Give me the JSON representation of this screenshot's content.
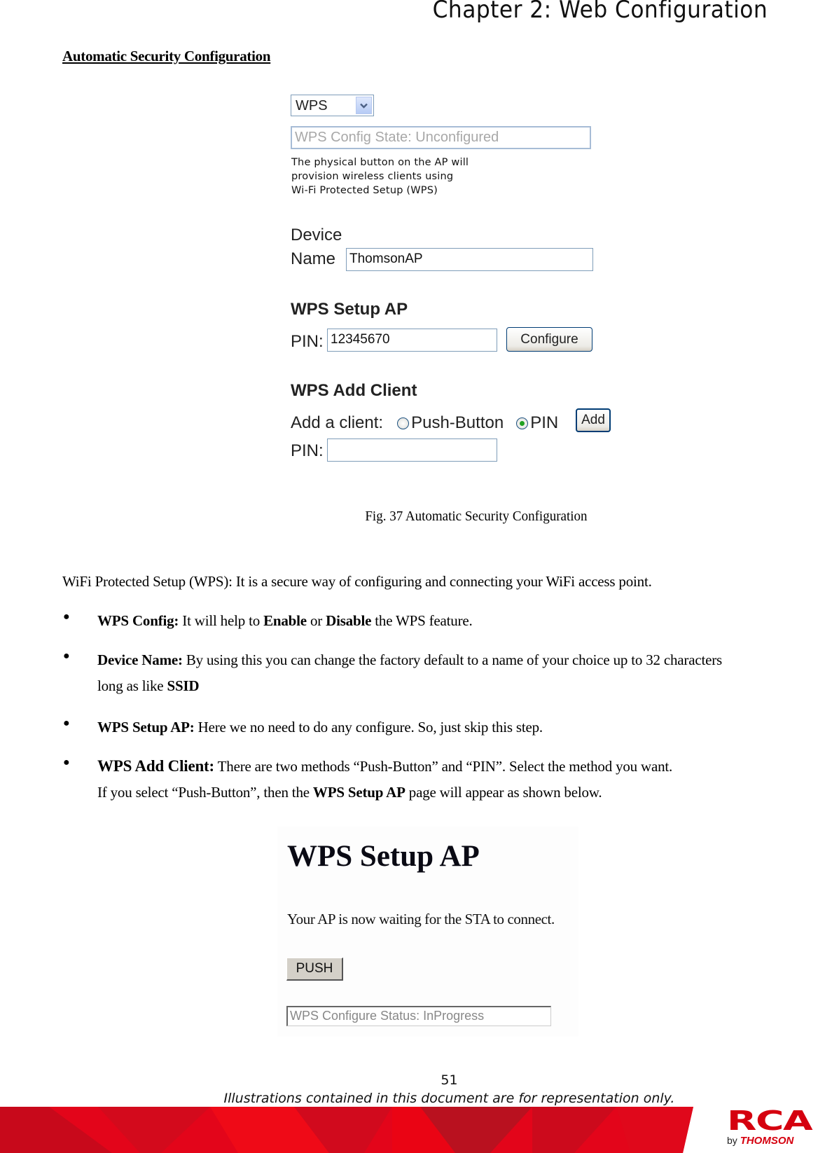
{
  "header": {
    "chapter_title": "Chapter 2: Web Configuration"
  },
  "section": {
    "heading": "Automatic Security Configuration"
  },
  "figure1": {
    "wps_select": {
      "value": "WPS",
      "icon": "chevron-down-icon"
    },
    "config_state": "WPS Config State: Unconfigured",
    "note_lines": [
      "The physical button on the AP will",
      "provision wireless clients using",
      "Wi-Fi Protected Setup (WPS)"
    ],
    "device_label_line1": "Device",
    "device_label_line2": "Name",
    "device_name_value": "ThomsonAP",
    "setup_ap_heading": "WPS Setup AP",
    "pin_label": "PIN:",
    "pin_value": "12345670",
    "configure_button": "Configure",
    "add_client_heading": "WPS Add Client",
    "add_client_label": "Add a client:",
    "radio_options": [
      {
        "label": "Push-Button",
        "selected": false
      },
      {
        "label": "PIN",
        "selected": true
      }
    ],
    "add_button": "Add",
    "pin_label_2": "PIN:",
    "pin_value_2": "",
    "caption": "Fig. 37 Automatic Security Configuration"
  },
  "body": {
    "intro": "WiFi Protected Setup (WPS): It is a secure way of configuring and connecting your WiFi access point.",
    "bullets": [
      {
        "term": "WPS Config:",
        "text_1": " It will help to ",
        "bold_1": "Enable",
        "text_2": " or ",
        "bold_2": "Disable",
        "text_3": " the WPS feature."
      },
      {
        "term": "Device Name:",
        "text_1": " By using this you can change the factory default to a name of your choice up to 32 characters",
        "cont_text": "long as like ",
        "cont_bold": "SSID"
      },
      {
        "term": "WPS Setup AP:",
        "text_1": " Here we no need to do any configure. So, just skip this step."
      },
      {
        "term": "WPS Add Client:",
        "text_1": " There are two methods “Push-Button” and “PIN”. Select the method you want.",
        "cont_text_1": "If you select “Push-Button”, then the ",
        "cont_bold": "WPS Setup AP",
        "cont_text_2": " page will appear as shown below."
      }
    ]
  },
  "figure2": {
    "heading": "WPS Setup AP",
    "message": "Your AP is now waiting for the STA to connect.",
    "push_button": "PUSH",
    "status": "WPS Configure Status: InProgress"
  },
  "footer": {
    "page_number": "51",
    "disclaimer": "Illustrations contained in this document are for representation only.",
    "brand_main": "RCA",
    "brand_sub_by": "by ",
    "brand_sub_name": "THOMSON",
    "brand_color": "#d5000f"
  }
}
